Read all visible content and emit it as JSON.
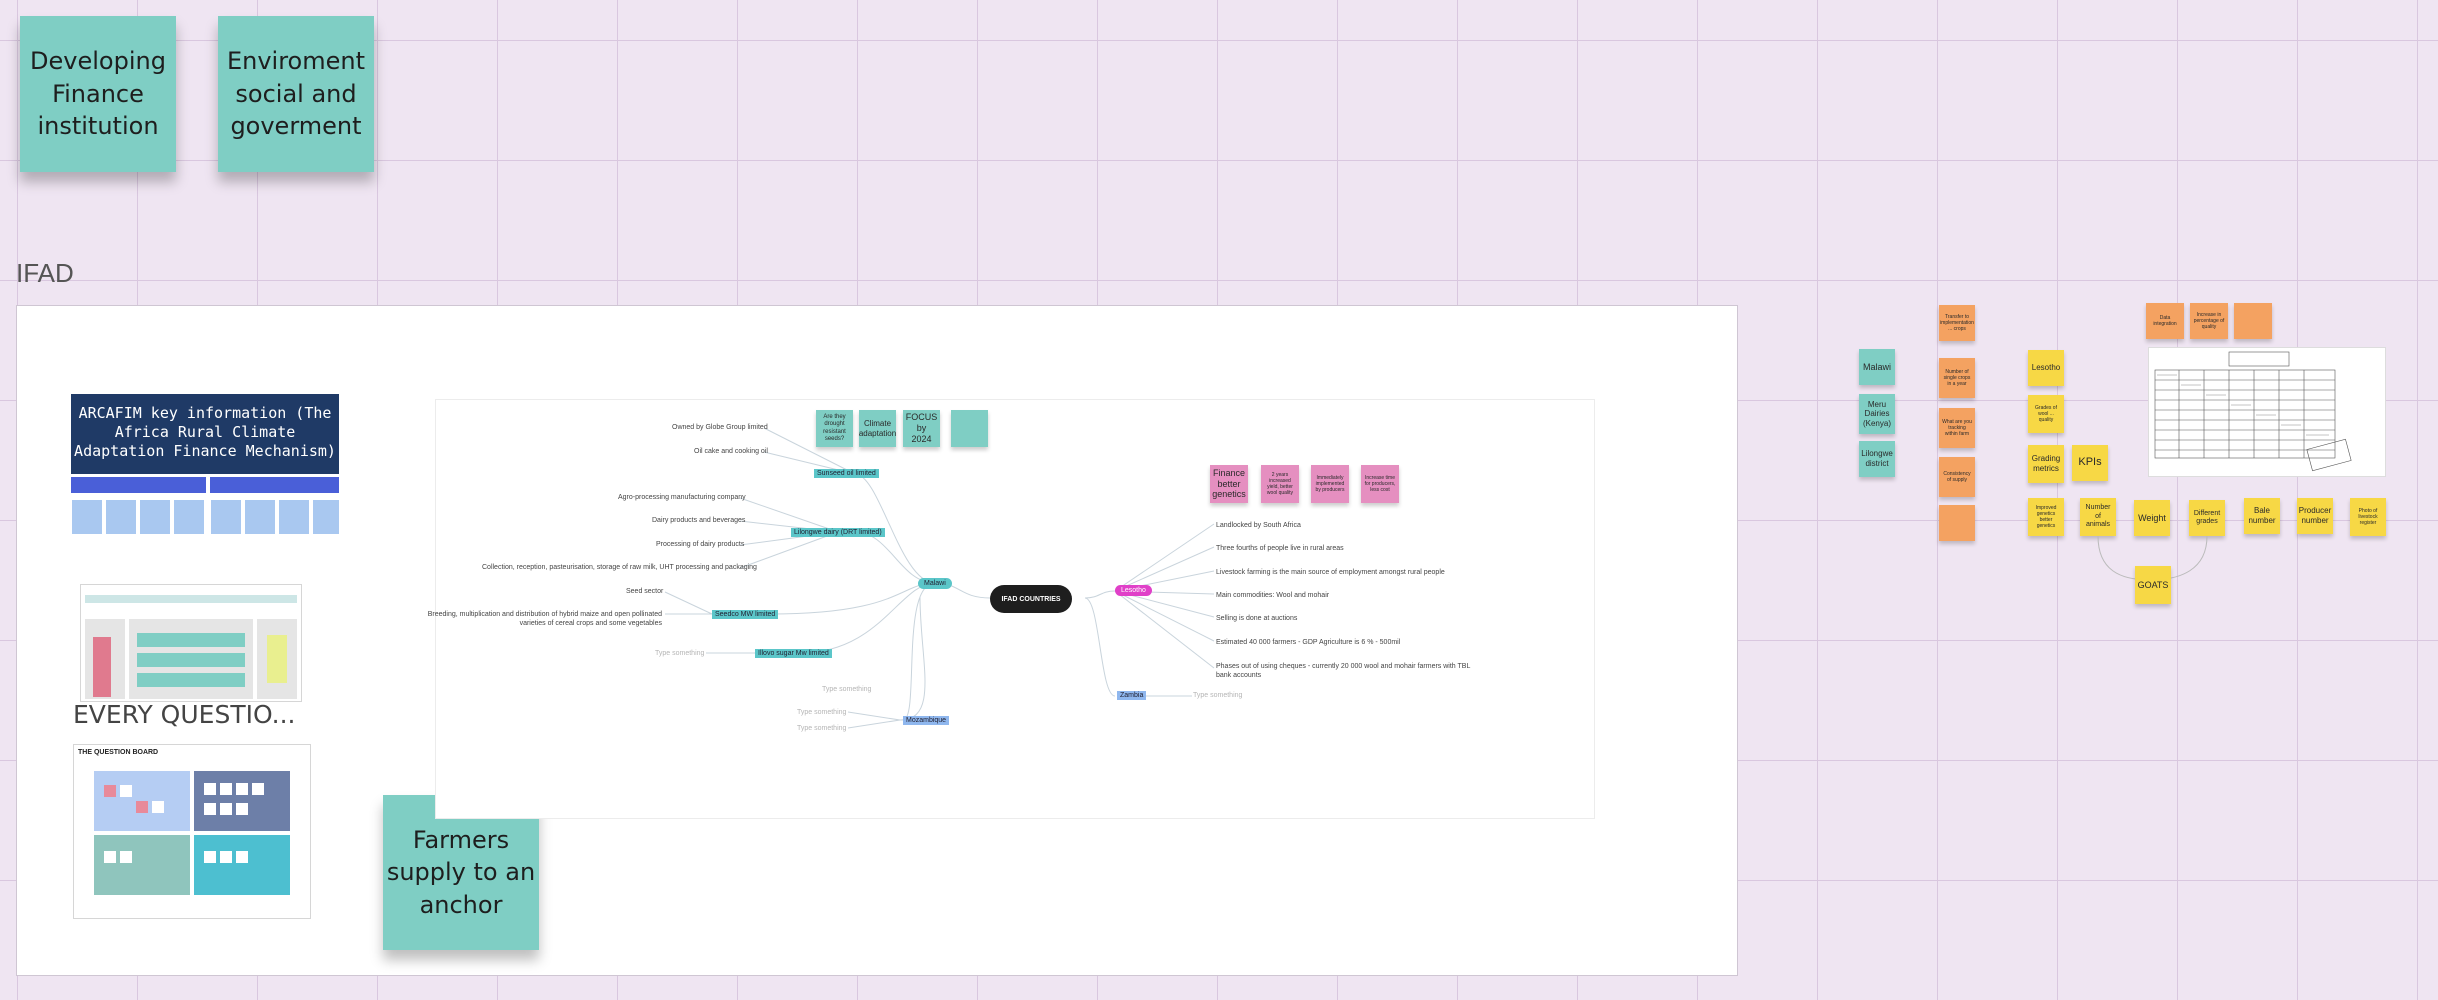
{
  "top_stickies": [
    {
      "text": "Developing Finance institution"
    },
    {
      "text": "Enviroment social and goverment"
    }
  ],
  "frame": {
    "title": "IFAD",
    "arcafim_title": "ARCAFIM key information (The Africa Rural Climate Adaptation Finance Mechanism)",
    "every_question": "EVERY QUESTIO...",
    "question_board_title": "THE QUESTION BOARD",
    "farmers_sticky": "Farmers supply to an anchor"
  },
  "mindmap": {
    "center": "IFAD COUNTRIES",
    "branches": {
      "malawi": "Malawi",
      "lesotho": "Lesotho",
      "zambia": "Zambia",
      "mozambique": "Mozambique"
    },
    "malawi_subs": {
      "sunseed": "Sunseed oil limited",
      "lilongwe": "Lilongwe dairy (DRT limited)",
      "seedco": "Seedco MW limited",
      "illovo": "Illovo sugar Mw limited"
    },
    "malawi_leaves": {
      "owned": "Owned by Globe Group limited",
      "oilcake": "Oil cake and cooking oil",
      "agro": "Agro-processing manufacturing company",
      "dairy": "Dairy products and beverages",
      "processing": "Processing of dairy products",
      "collection": "Collection, reception, pasteurisation, storage of raw milk, UHT processing and packaging",
      "seed": "Seed sector",
      "breeding": "Breeding, multiplication and distribution of hybrid maize and open pollinated varieties of cereal crops and some vegetables"
    },
    "lesotho_leaves": {
      "l1": "Landlocked by South Africa",
      "l2": "Three fourths of people live in rural areas",
      "l3": "Livestock farming is the main source of employment amongst rural people",
      "l4": "Main commodities: Wool and mohair",
      "l5": "Selling is done at auctions",
      "l6": "Estimated 40 000 farmers - GDP Agriculture is 6 % - 500mil",
      "l7": "Phases out of using cheques - currently 20 000 wool and mohair farmers with TBL bank accounts"
    },
    "placeholder": "Type something",
    "teal_notes": [
      "Are they drought resistant seeds?",
      "Climate adaptation",
      "FOCUS by 2024",
      ""
    ],
    "pink_notes": [
      "Finance better genetics",
      "2 years increased yield, better wool quality",
      "Immediately implemented by producers",
      "Increase time for producers, less cost"
    ]
  },
  "right": {
    "teal": [
      "Malawi",
      "Meru Dairies (Kenya)",
      "Lilongwe district"
    ],
    "orange": [
      "Transfer to implementation ... crops",
      "Number of single crops in a year",
      "What are you tracking within farm",
      "Consistency of supply",
      ""
    ],
    "yellow_col": [
      "Lesotho",
      "Grades of wool ... quality",
      "Grading metrics"
    ],
    "kpis": "KPIs",
    "kpi_row": [
      "Improved genetics better genetics",
      "Number of animals",
      "Weight",
      "Different grades",
      "Bale number",
      "Producer number",
      "Photo of livestock register"
    ],
    "goats": "GOATS",
    "top_orange": [
      "Data integration",
      "Increase in percentage of quality",
      ""
    ]
  },
  "colors": {
    "teal": "#7fcec4",
    "pink": "#e58fc0",
    "orange": "#f4a261",
    "yellow": "#f7d845",
    "magenta": "#e040c8"
  }
}
